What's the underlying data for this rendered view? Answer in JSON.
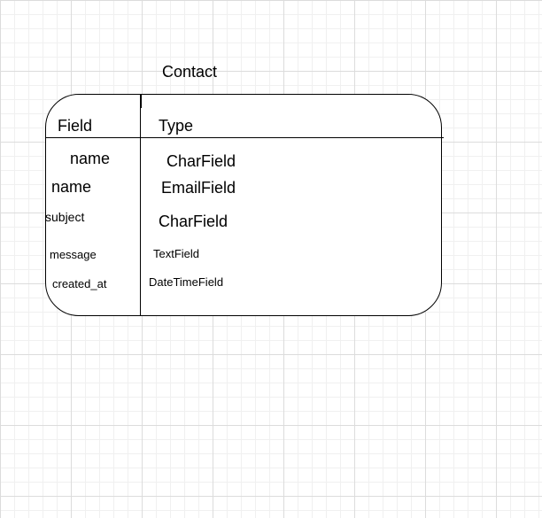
{
  "diagram": {
    "title": "Contact",
    "headers": {
      "field": "Field",
      "type": "Type"
    },
    "rows": [
      {
        "field": "name",
        "type": "CharField"
      },
      {
        "field": "name",
        "type": "EmailField"
      },
      {
        "field": "subject",
        "type": "CharField"
      },
      {
        "field": "message",
        "type": "TextField"
      },
      {
        "field": "created_at",
        "type": "DateTimeField"
      }
    ]
  }
}
